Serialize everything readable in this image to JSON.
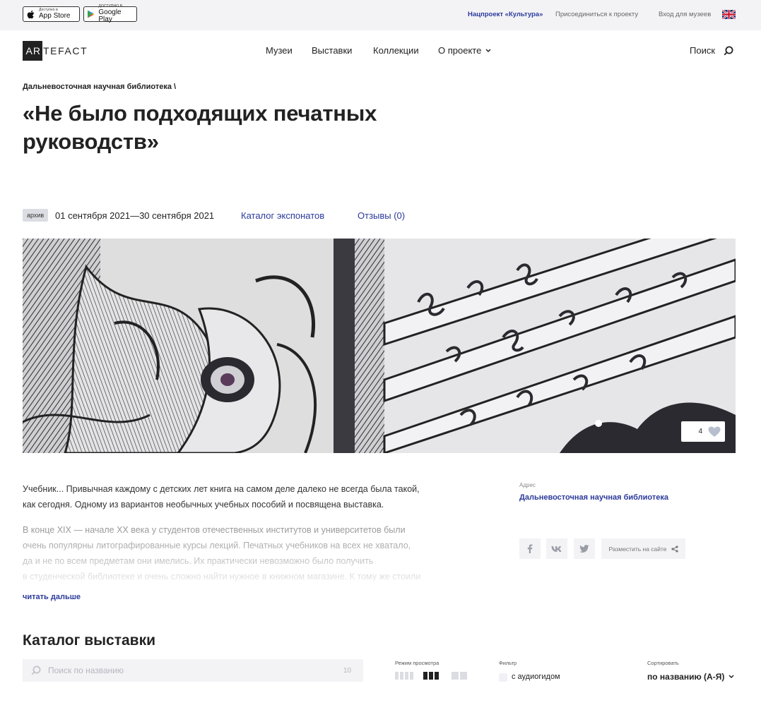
{
  "topbar": {
    "app_store": {
      "small": "Доступно в",
      "big": "App Store"
    },
    "google_play": {
      "small": "ДОСТУПНО В",
      "big": "Google Play"
    },
    "links": [
      "Нацпроект «Культура»",
      "Присоединиться к проекту",
      "Вход для музеев"
    ],
    "lang_flag": "uk-flag-icon"
  },
  "header": {
    "logo_box": "AR",
    "logo_rest": "TEFACT",
    "nav": [
      "Музеи",
      "Выставки",
      "Коллекции",
      "О проекте"
    ],
    "search_label": "Поиск"
  },
  "exhibition": {
    "breadcrumb": "Дальневосточная научная библиотека \\",
    "title_line1": "«Не было подходящих печатных",
    "title_line2": "руководств»",
    "status_badge": "архив",
    "dates": "01 сентября 2021—30 сентября 2021",
    "tabs": [
      "Каталог экспонатов",
      "Отзывы (0)"
    ],
    "likes": "4"
  },
  "description": {
    "p1_line1": "Учебник... Привычная каждому с детских лет книга на самом деле далеко не всегда была такой,",
    "p1_line2": "как сегодня. Одному из вариантов необычных учебных пособий и посвящена выставка.",
    "p2_line1": "В конце XIX — начале XX века у студентов отечественных институтов и университетов были",
    "p2_line2": "очень популярны литографированные курсы лекций. Печатных учебников на всех не хватало,",
    "p2_line3": "да и не по всем предметам они имелись. Их практически невозможно было получить",
    "p2_line4": "в студенческой библиотеке и очень сложно найти нужное в книжном магазине. К тому же стоили",
    "read_more": "читать дальше"
  },
  "sidebar": {
    "address_label": "Адрес",
    "address_value": "Дальневосточная научная библиотека",
    "share_site": "Разместить на сайте"
  },
  "catalog": {
    "title": "Каталог выставки",
    "search_placeholder": "Поиск по названию",
    "count": "10",
    "view_mode_label": "Режим просмотра",
    "filter_label": "Фильтр",
    "filter_option": "с аудиогидом",
    "sort_label": "Сортировать",
    "sort_value": "по названию (А-Я)"
  },
  "colors": {
    "accent": "#2b3a9b",
    "text": "#222222",
    "muted_bg": "#f3f3f6"
  }
}
